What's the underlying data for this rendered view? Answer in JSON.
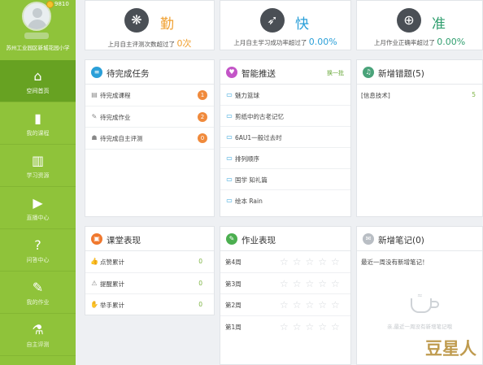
{
  "profile": {
    "coins": "9810",
    "school": "苏州工业园区新城花园小学"
  },
  "nav": [
    {
      "label": "空间首页",
      "icon": "home-icon",
      "glyph": "⌂"
    },
    {
      "label": "我的课程",
      "icon": "book-icon",
      "glyph": "▮"
    },
    {
      "label": "学习资源",
      "icon": "library-icon",
      "glyph": "▥"
    },
    {
      "label": "直播中心",
      "icon": "play-icon",
      "glyph": "▶"
    },
    {
      "label": "问答中心",
      "icon": "question-icon",
      "glyph": "?"
    },
    {
      "label": "我的作业",
      "icon": "pencil-icon",
      "glyph": "✎"
    },
    {
      "label": "自主评测",
      "icon": "flask-icon",
      "glyph": "⚗"
    }
  ],
  "stats": [
    {
      "title": "勤",
      "prefix": "上月自主评测次数超过了",
      "value": "0次",
      "icon": "bee-icon",
      "glyph": "❋",
      "color": "#f0a030"
    },
    {
      "title": "快",
      "prefix": "上月自主学习成功率超过了",
      "value": "0.00%",
      "icon": "rocket-icon",
      "glyph": "➶",
      "color": "#2a9fd8"
    },
    {
      "title": "准",
      "prefix": "上月作业正确率超过了",
      "value": "0.00%",
      "icon": "target-icon",
      "glyph": "⊕",
      "color": "#2f9e6e"
    }
  ],
  "tasks": {
    "title": "待完成任务",
    "items": [
      {
        "label": "待完成课程",
        "count": "1",
        "icon": "document-icon",
        "glyph": "▤"
      },
      {
        "label": "待完成作业",
        "count": "2",
        "icon": "pencil-icon",
        "glyph": "✎"
      },
      {
        "label": "待完成自主评测",
        "count": "0",
        "icon": "user-icon",
        "glyph": "☗"
      }
    ]
  },
  "push": {
    "title": "智能推送",
    "link": "换一批",
    "items": [
      "魅力篮球",
      "剪纸中的古老记忆",
      "6AU1一般过去时",
      "排列顺序",
      "国学 知礼篇",
      "绘本 Rain"
    ]
  },
  "wrong": {
    "title": "新增错题(5)",
    "items": [
      {
        "label": "[信息技术]",
        "count": "5"
      }
    ]
  },
  "classroom": {
    "title": "课堂表现",
    "items": [
      {
        "label": "点赞累计",
        "count": "0",
        "icon": "thumb-icon",
        "glyph": "👍"
      },
      {
        "label": "提醒累计",
        "count": "0",
        "icon": "warning-icon",
        "glyph": "⚠"
      },
      {
        "label": "举手累计",
        "count": "0",
        "icon": "hand-icon",
        "glyph": "✋"
      }
    ]
  },
  "homework": {
    "title": "作业表现",
    "weeks": [
      "第4周",
      "第3周",
      "第2周",
      "第1周"
    ],
    "stars": "☆☆☆☆☆"
  },
  "notes": {
    "title": "新增笔记(0)",
    "message": "最近一周没有新增笔记！",
    "empty": "亲,最近一周没有新增笔记哦"
  },
  "watermark": "豆星人"
}
